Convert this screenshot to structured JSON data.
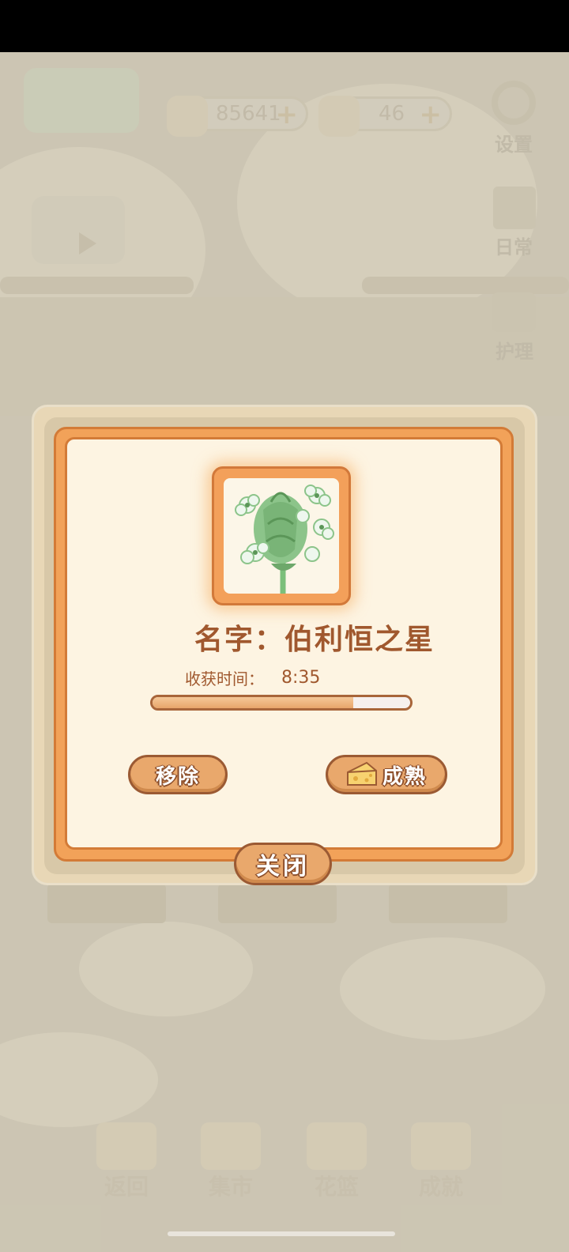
{
  "hud": {
    "fish_count": "85641",
    "cheese_count": "46",
    "settings_label": "设置",
    "daily_label": "日常",
    "care_label": "护理"
  },
  "dialog": {
    "name_label": "名字：",
    "plant_name": "伯利恒之星",
    "harvest_label": "收获时间：",
    "harvest_time": "8:35",
    "progress_fraction": 0.78,
    "remove_label": "移除",
    "mature_label": "成熟",
    "close_label": "关闭"
  },
  "bottom_nav": {
    "back_label": "返回",
    "market_label": "集市",
    "basket_label": "花篮",
    "achievement_label": "成就"
  },
  "colors": {
    "accent_orange": "#f2a259",
    "text_brown": "#a0582e",
    "button_fill": "#e9a86c"
  }
}
